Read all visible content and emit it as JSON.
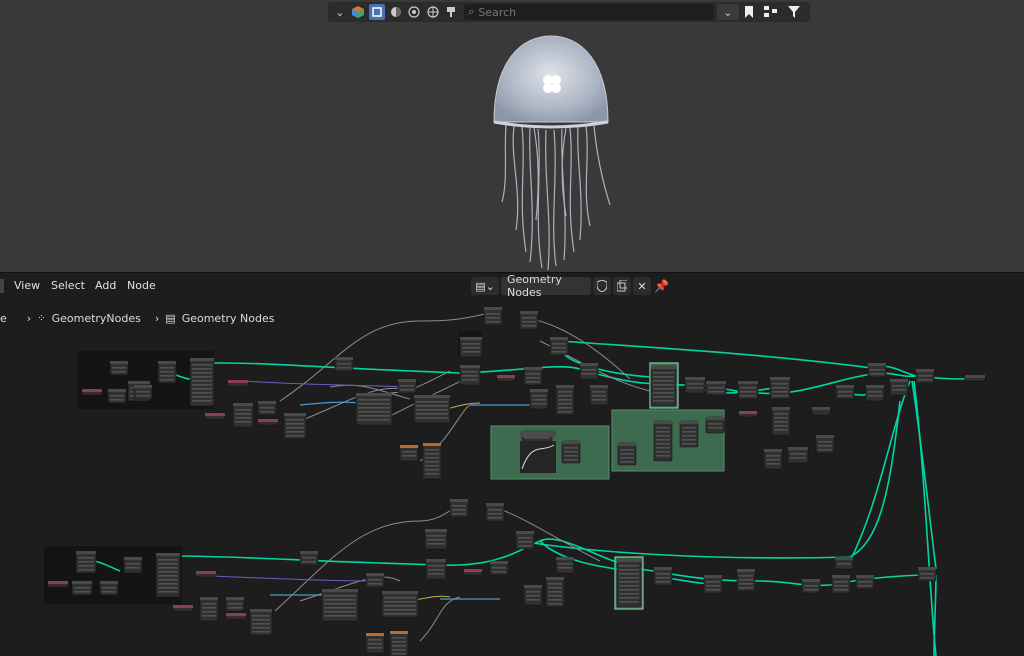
{
  "viewport": {
    "search_placeholder": "Search",
    "header_icons": [
      "chevron-down-icon",
      "object-type-icon",
      "solid-shading-icon",
      "material-shading-icon",
      "rendered-shading-icon",
      "render-shading-icon",
      "brush-icon",
      "search-icon",
      "chevron-down-icon",
      "bookmark-icon",
      "hierarchy-icon",
      "filter-icon"
    ]
  },
  "node_editor": {
    "menu": {
      "view": "View",
      "select": "Select",
      "add": "Add",
      "node": "Node"
    },
    "tree_name": "Geometry Nodes",
    "breadcrumb": {
      "partial": "e",
      "modifier": "GeometryNodes",
      "tree": "Geometry Nodes"
    },
    "colors": {
      "link_geometry": "#00d6a3",
      "link_float": "#a1a1a1",
      "link_vector": "#6363c7",
      "frame": "#3d6b4f",
      "node_bg": "#303030",
      "node_header": "#4a4a4a",
      "input_node_header": "#8a3e51",
      "vector_node_header": "#3d4a8a",
      "texture_node_header": "#c16a27"
    }
  }
}
